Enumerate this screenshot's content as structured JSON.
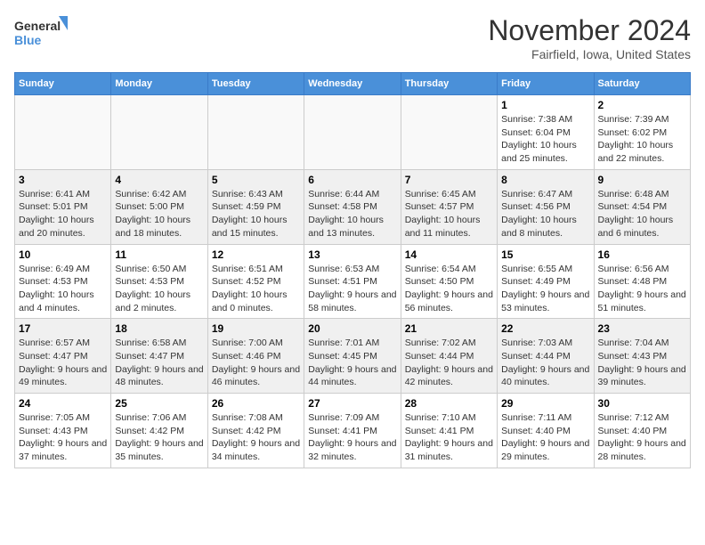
{
  "logo": {
    "line1": "General",
    "line2": "Blue"
  },
  "title": "November 2024",
  "location": "Fairfield, Iowa, United States",
  "days_of_week": [
    "Sunday",
    "Monday",
    "Tuesday",
    "Wednesday",
    "Thursday",
    "Friday",
    "Saturday"
  ],
  "weeks": [
    [
      {
        "day": "",
        "empty": true
      },
      {
        "day": "",
        "empty": true
      },
      {
        "day": "",
        "empty": true
      },
      {
        "day": "",
        "empty": true
      },
      {
        "day": "",
        "empty": true
      },
      {
        "day": "1",
        "sunrise": "Sunrise: 7:38 AM",
        "sunset": "Sunset: 6:04 PM",
        "daylight": "Daylight: 10 hours and 25 minutes."
      },
      {
        "day": "2",
        "sunrise": "Sunrise: 7:39 AM",
        "sunset": "Sunset: 6:02 PM",
        "daylight": "Daylight: 10 hours and 22 minutes."
      }
    ],
    [
      {
        "day": "3",
        "sunrise": "Sunrise: 6:41 AM",
        "sunset": "Sunset: 5:01 PM",
        "daylight": "Daylight: 10 hours and 20 minutes."
      },
      {
        "day": "4",
        "sunrise": "Sunrise: 6:42 AM",
        "sunset": "Sunset: 5:00 PM",
        "daylight": "Daylight: 10 hours and 18 minutes."
      },
      {
        "day": "5",
        "sunrise": "Sunrise: 6:43 AM",
        "sunset": "Sunset: 4:59 PM",
        "daylight": "Daylight: 10 hours and 15 minutes."
      },
      {
        "day": "6",
        "sunrise": "Sunrise: 6:44 AM",
        "sunset": "Sunset: 4:58 PM",
        "daylight": "Daylight: 10 hours and 13 minutes."
      },
      {
        "day": "7",
        "sunrise": "Sunrise: 6:45 AM",
        "sunset": "Sunset: 4:57 PM",
        "daylight": "Daylight: 10 hours and 11 minutes."
      },
      {
        "day": "8",
        "sunrise": "Sunrise: 6:47 AM",
        "sunset": "Sunset: 4:56 PM",
        "daylight": "Daylight: 10 hours and 8 minutes."
      },
      {
        "day": "9",
        "sunrise": "Sunrise: 6:48 AM",
        "sunset": "Sunset: 4:54 PM",
        "daylight": "Daylight: 10 hours and 6 minutes."
      }
    ],
    [
      {
        "day": "10",
        "sunrise": "Sunrise: 6:49 AM",
        "sunset": "Sunset: 4:53 PM",
        "daylight": "Daylight: 10 hours and 4 minutes."
      },
      {
        "day": "11",
        "sunrise": "Sunrise: 6:50 AM",
        "sunset": "Sunset: 4:53 PM",
        "daylight": "Daylight: 10 hours and 2 minutes."
      },
      {
        "day": "12",
        "sunrise": "Sunrise: 6:51 AM",
        "sunset": "Sunset: 4:52 PM",
        "daylight": "Daylight: 10 hours and 0 minutes."
      },
      {
        "day": "13",
        "sunrise": "Sunrise: 6:53 AM",
        "sunset": "Sunset: 4:51 PM",
        "daylight": "Daylight: 9 hours and 58 minutes."
      },
      {
        "day": "14",
        "sunrise": "Sunrise: 6:54 AM",
        "sunset": "Sunset: 4:50 PM",
        "daylight": "Daylight: 9 hours and 56 minutes."
      },
      {
        "day": "15",
        "sunrise": "Sunrise: 6:55 AM",
        "sunset": "Sunset: 4:49 PM",
        "daylight": "Daylight: 9 hours and 53 minutes."
      },
      {
        "day": "16",
        "sunrise": "Sunrise: 6:56 AM",
        "sunset": "Sunset: 4:48 PM",
        "daylight": "Daylight: 9 hours and 51 minutes."
      }
    ],
    [
      {
        "day": "17",
        "sunrise": "Sunrise: 6:57 AM",
        "sunset": "Sunset: 4:47 PM",
        "daylight": "Daylight: 9 hours and 49 minutes."
      },
      {
        "day": "18",
        "sunrise": "Sunrise: 6:58 AM",
        "sunset": "Sunset: 4:47 PM",
        "daylight": "Daylight: 9 hours and 48 minutes."
      },
      {
        "day": "19",
        "sunrise": "Sunrise: 7:00 AM",
        "sunset": "Sunset: 4:46 PM",
        "daylight": "Daylight: 9 hours and 46 minutes."
      },
      {
        "day": "20",
        "sunrise": "Sunrise: 7:01 AM",
        "sunset": "Sunset: 4:45 PM",
        "daylight": "Daylight: 9 hours and 44 minutes."
      },
      {
        "day": "21",
        "sunrise": "Sunrise: 7:02 AM",
        "sunset": "Sunset: 4:44 PM",
        "daylight": "Daylight: 9 hours and 42 minutes."
      },
      {
        "day": "22",
        "sunrise": "Sunrise: 7:03 AM",
        "sunset": "Sunset: 4:44 PM",
        "daylight": "Daylight: 9 hours and 40 minutes."
      },
      {
        "day": "23",
        "sunrise": "Sunrise: 7:04 AM",
        "sunset": "Sunset: 4:43 PM",
        "daylight": "Daylight: 9 hours and 39 minutes."
      }
    ],
    [
      {
        "day": "24",
        "sunrise": "Sunrise: 7:05 AM",
        "sunset": "Sunset: 4:43 PM",
        "daylight": "Daylight: 9 hours and 37 minutes."
      },
      {
        "day": "25",
        "sunrise": "Sunrise: 7:06 AM",
        "sunset": "Sunset: 4:42 PM",
        "daylight": "Daylight: 9 hours and 35 minutes."
      },
      {
        "day": "26",
        "sunrise": "Sunrise: 7:08 AM",
        "sunset": "Sunset: 4:42 PM",
        "daylight": "Daylight: 9 hours and 34 minutes."
      },
      {
        "day": "27",
        "sunrise": "Sunrise: 7:09 AM",
        "sunset": "Sunset: 4:41 PM",
        "daylight": "Daylight: 9 hours and 32 minutes."
      },
      {
        "day": "28",
        "sunrise": "Sunrise: 7:10 AM",
        "sunset": "Sunset: 4:41 PM",
        "daylight": "Daylight: 9 hours and 31 minutes."
      },
      {
        "day": "29",
        "sunrise": "Sunrise: 7:11 AM",
        "sunset": "Sunset: 4:40 PM",
        "daylight": "Daylight: 9 hours and 29 minutes."
      },
      {
        "day": "30",
        "sunrise": "Sunrise: 7:12 AM",
        "sunset": "Sunset: 4:40 PM",
        "daylight": "Daylight: 9 hours and 28 minutes."
      }
    ]
  ]
}
